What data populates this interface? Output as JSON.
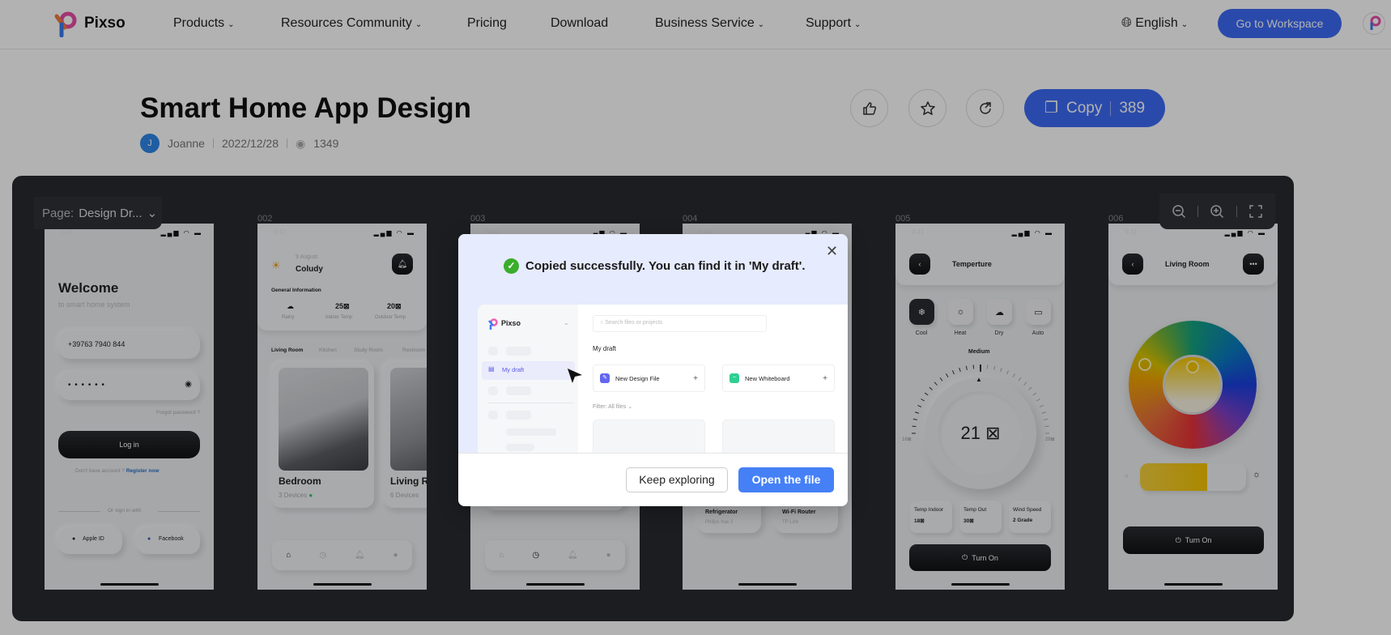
{
  "nav": {
    "brand": "Pixso",
    "items": [
      {
        "label": "Products",
        "dropdown": true
      },
      {
        "label": "Resources Community",
        "dropdown": true
      },
      {
        "label": "Pricing",
        "dropdown": false
      },
      {
        "label": "Download",
        "dropdown": false
      },
      {
        "label": "Business Service",
        "dropdown": true
      },
      {
        "label": "Support",
        "dropdown": true
      }
    ],
    "language": "English",
    "workspace_button": "Go to Workspace",
    "accent": "#3d6af5"
  },
  "header": {
    "title": "Smart Home App Design",
    "author_initial": "J",
    "author": "Joanne",
    "date": "2022/12/28",
    "views": "1349",
    "copy_label": "Copy",
    "copy_count": "389"
  },
  "canvas": {
    "page_label": "Page:",
    "page_value": "Design Dr...",
    "frames": [
      "",
      "002",
      "003",
      "004",
      "005",
      "006"
    ]
  },
  "screens": {
    "status_time": "9:41",
    "login": {
      "title": "Welcome",
      "subtitle": "to smart home system",
      "phone": "+39763 7940 844",
      "password": "• • • • • •",
      "forgot": "Forgot password ?",
      "login_btn": "Log in",
      "no_account": "Don't have account ?",
      "register": "Register now",
      "or_sign": "Or sign in with",
      "apple": "Apple ID",
      "facebook": "Facebook"
    },
    "home": {
      "date": "9 August",
      "weather": "Coludy",
      "general": "General Information",
      "stats": [
        {
          "value": "",
          "label": "Rainy"
        },
        {
          "value": "25⊠",
          "label": "Indoor Temp"
        },
        {
          "value": "20⊠",
          "label": "Outdoor Temp"
        }
      ],
      "tabs": [
        "Living Room",
        "Kitchen",
        "Study Room",
        "Restroom"
      ],
      "rooms": [
        {
          "name": "Bedroom",
          "devices": "3 Devices"
        },
        {
          "name": "Living R",
          "devices": "6 Devices"
        }
      ]
    },
    "devices": {
      "cards": [
        {
          "name": "Refrigerator",
          "brand": "Philips hue 2"
        },
        {
          "name": "Wi-Fi Router",
          "brand": "TP Link"
        }
      ]
    },
    "temperature": {
      "title": "Temperture",
      "modes": [
        "Cool",
        "Heat",
        "Dry",
        "Auto"
      ],
      "active_mode": "Cool",
      "speed": "Medium",
      "value": "21 ⊠",
      "min": "16⊠",
      "max": "28⊠",
      "stats": [
        {
          "label": "Temp Indoor",
          "value": "18⊠"
        },
        {
          "label": "Temp Out",
          "value": "30⊠"
        },
        {
          "label": "Wind Speed",
          "value": "2 Grade"
        }
      ],
      "turn_on": "Turn On"
    },
    "light": {
      "title": "Living Room",
      "brightness": 0.63,
      "brightness_color": "#f5c400",
      "turn_on": "Turn On"
    }
  },
  "modal": {
    "message": "Copied successfully. You can find it in 'My draft'.",
    "preview": {
      "brand": "Pixso",
      "sidebar_active": "My draft",
      "search_placeholder": "Search files or projects",
      "section": "My draft",
      "new_design": "New Design File",
      "new_whiteboard": "New Whiteboard",
      "filter_label": "Filter:",
      "filter_value": "All files"
    },
    "keep_button": "Keep exploring",
    "open_button": "Open the file",
    "open_color": "#4580f7",
    "success_color": "#3aad2b"
  }
}
